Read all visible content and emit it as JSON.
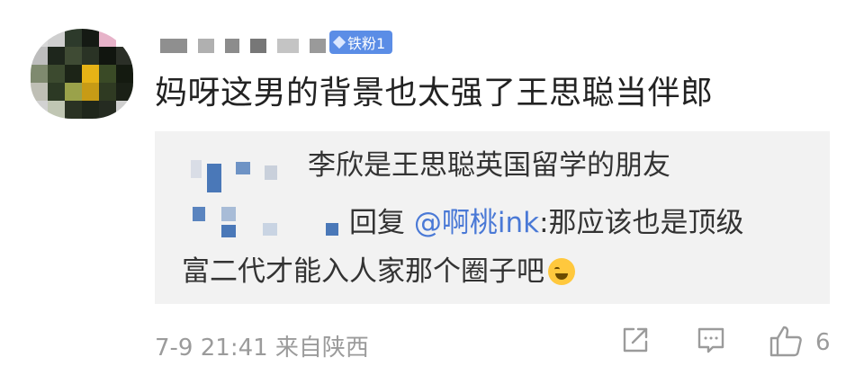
{
  "comment": {
    "username_blurred": true,
    "badge": "铁粉1",
    "text": "妈呀这男的背景也太强了王思聪当伴郎",
    "quoted": {
      "line1": "李欣是王思聪英国留学的朋友",
      "reply_prefix": "回复 ",
      "mention": "@啊桃ink",
      "line2_rest": ":那应该也是顶级",
      "line3": "富二代才能入人家那个圈子吧",
      "emoji_icon": "laugh-cry-emoji"
    },
    "timestamp": "7-9 21:41 来自陕西",
    "like_count": "6"
  },
  "colors": {
    "badge_bg": "#5b8de6",
    "mention": "#4a79d6",
    "quote_bg": "#f2f2f2",
    "meta_text": "#9b9b9b"
  },
  "icons": [
    "share-icon",
    "comment-icon",
    "like-icon"
  ]
}
